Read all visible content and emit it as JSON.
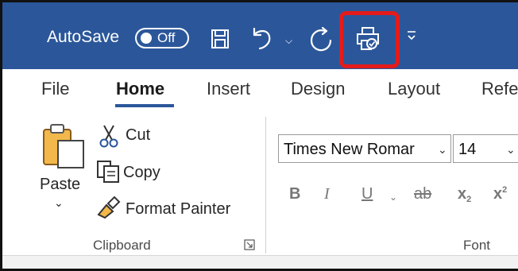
{
  "titlebar": {
    "autosave_label": "AutoSave",
    "autosave_state": "Off",
    "bg_color": "#2b579a",
    "qat": [
      {
        "icon": "save-icon"
      },
      {
        "icon": "undo-icon"
      },
      {
        "icon": "redo-icon"
      },
      {
        "icon": "print-preview-icon",
        "highlighted": true
      },
      {
        "icon": "customize-qat-icon"
      }
    ],
    "highlight_color": "#e31b1b"
  },
  "tabs": [
    {
      "label": "File"
    },
    {
      "label": "Home",
      "active": true
    },
    {
      "label": "Insert"
    },
    {
      "label": "Design"
    },
    {
      "label": "Layout"
    },
    {
      "label": "Refe"
    }
  ],
  "clipboard": {
    "paste_label": "Paste",
    "cut_label": "Cut",
    "copy_label": "Copy",
    "format_painter_label": "Format Painter",
    "group_label": "Clipboard"
  },
  "font": {
    "font_name": "Times New Romar",
    "font_size": "14",
    "bold": "B",
    "italic": "I",
    "underline": "U",
    "strikethrough": "ab",
    "subscript": "x",
    "subscript_mark": "2",
    "superscript": "x",
    "superscript_mark": "2",
    "group_label": "Font"
  }
}
